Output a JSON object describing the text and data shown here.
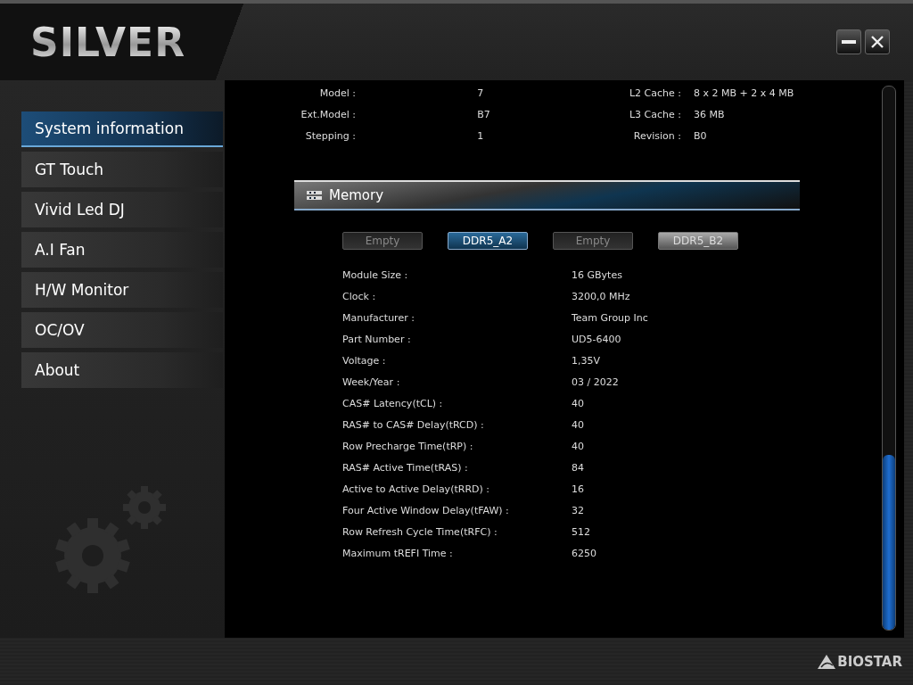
{
  "app": {
    "title": "SILVER",
    "brand": "BIOSTAR"
  },
  "sidebar": {
    "items": [
      {
        "label": "System information",
        "selected": true
      },
      {
        "label": "GT Touch",
        "selected": false
      },
      {
        "label": "Vivid Led DJ",
        "selected": false
      },
      {
        "label": "A.I Fan",
        "selected": false
      },
      {
        "label": "H/W Monitor",
        "selected": false
      },
      {
        "label": "OC/OV",
        "selected": false
      },
      {
        "label": "About",
        "selected": false
      }
    ]
  },
  "cpu": {
    "left": [
      {
        "label": "Model :",
        "value": "7"
      },
      {
        "label": "Ext.Model :",
        "value": "B7"
      },
      {
        "label": "Stepping :",
        "value": "1"
      }
    ],
    "right": [
      {
        "label": "L2 Cache :",
        "value": "8 x 2 MB + 2 x 4 MB"
      },
      {
        "label": "L3 Cache :",
        "value": "36 MB"
      },
      {
        "label": "Revision :",
        "value": "B0"
      }
    ]
  },
  "memory": {
    "title": "Memory",
    "slots": [
      {
        "label": "Empty",
        "selected": false,
        "disabled": true
      },
      {
        "label": "DDR5_A2",
        "selected": true,
        "disabled": false
      },
      {
        "label": "Empty",
        "selected": false,
        "disabled": true
      },
      {
        "label": "DDR5_B2",
        "selected": false,
        "disabled": false
      }
    ],
    "rows": [
      {
        "label": "Module Size :",
        "value": "16 GBytes"
      },
      {
        "label": "Clock :",
        "value": "3200,0 MHz"
      },
      {
        "label": "Manufacturer :",
        "value": "Team Group Inc"
      },
      {
        "label": "Part Number :",
        "value": "UD5-6400"
      },
      {
        "label": "Voltage :",
        "value": "1,35V"
      },
      {
        "label": "Week/Year :",
        "value": "03 / 2022"
      },
      {
        "label": "CAS# Latency(tCL) :",
        "value": "40"
      },
      {
        "label": "RAS# to CAS# Delay(tRCD) :",
        "value": "40"
      },
      {
        "label": "Row Precharge Time(tRP) :",
        "value": "40"
      },
      {
        "label": "RAS# Active Time(tRAS) :",
        "value": "84"
      },
      {
        "label": "Active to Active Delay(tRRD) :",
        "value": "16"
      },
      {
        "label": "Four Active Window Delay(tFAW) :",
        "value": "32"
      },
      {
        "label": "Row Refresh Cycle Time(tRFC) :",
        "value": "512"
      },
      {
        "label": "Maximum tREFI Time :",
        "value": "6250"
      }
    ]
  }
}
